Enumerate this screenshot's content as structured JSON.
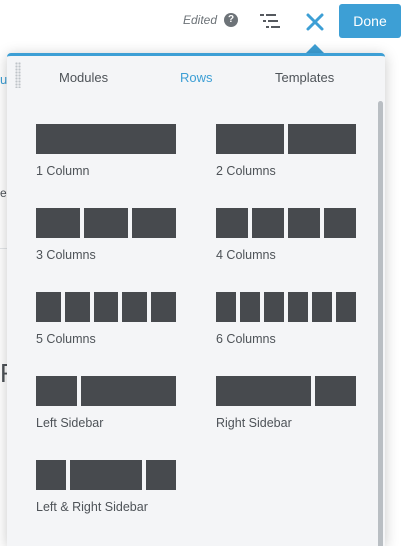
{
  "toolbar": {
    "edited_label": "Edited",
    "help_icon": "?",
    "outline_icon": "outline-list-icon",
    "close_icon": "close-x-icon",
    "done_label": "Done"
  },
  "background_fragments": {
    "top": "ut",
    "middle": "ea",
    "lower": "R"
  },
  "panel": {
    "tabs": [
      {
        "label": "Modules",
        "active": false
      },
      {
        "label": "Rows",
        "active": true
      },
      {
        "label": "Templates",
        "active": false
      }
    ],
    "rows": [
      {
        "label": "1 Column"
      },
      {
        "label": "2 Columns"
      },
      {
        "label": "3 Columns"
      },
      {
        "label": "4 Columns"
      },
      {
        "label": "5 Columns"
      },
      {
        "label": "6 Columns"
      },
      {
        "label": "Left Sidebar"
      },
      {
        "label": "Right Sidebar"
      },
      {
        "label": "Left & Right Sidebar"
      }
    ]
  },
  "colors": {
    "accent": "#3d9fd5",
    "block": "#474a4e",
    "panel_bg": "#f4f5f7"
  }
}
